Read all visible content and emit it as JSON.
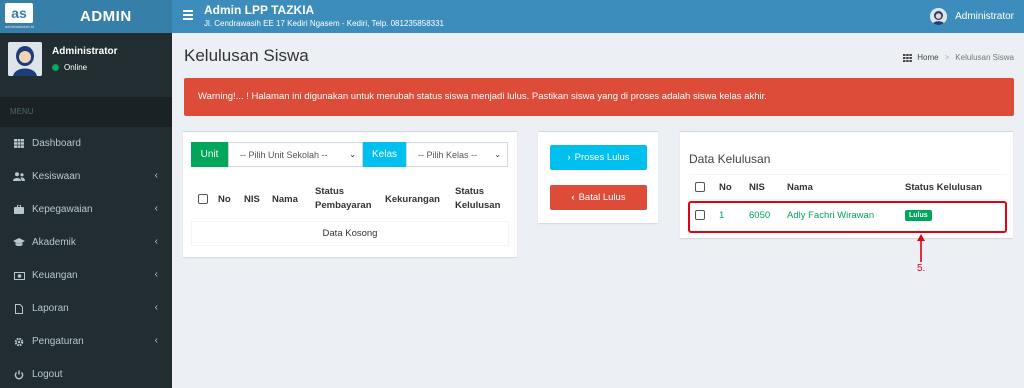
{
  "brand": {
    "logo_letters": "as",
    "logo_sub": "adminsekolah.id",
    "title": "ADMIN"
  },
  "user": {
    "name": "Administrator",
    "status": "Online"
  },
  "menu_header": "MENU",
  "menu": [
    {
      "label": "Dashboard",
      "icon": "th-icon",
      "has_children": false
    },
    {
      "label": "Kesiswaan",
      "icon": "users-icon",
      "has_children": true
    },
    {
      "label": "Kepegawaian",
      "icon": "briefcase-icon",
      "has_children": true
    },
    {
      "label": "Akademik",
      "icon": "graduation-cap-icon",
      "has_children": true
    },
    {
      "label": "Keuangan",
      "icon": "money-icon",
      "has_children": true
    },
    {
      "label": "Laporan",
      "icon": "file-icon",
      "has_children": true
    },
    {
      "label": "Pengaturan",
      "icon": "gear-icon",
      "has_children": true
    },
    {
      "label": "Logout",
      "icon": "power-icon",
      "has_children": false
    }
  ],
  "topbar": {
    "title": "Admin LPP TAZKIA",
    "address": "Jl. Cendrawasih EE 17 Kediri Ngasem - Kediri, Telp. 081235858331",
    "user": "Administrator"
  },
  "page": {
    "title": "Kelulusan Siswa",
    "breadcrumb": {
      "home": "Home",
      "current": "Kelulusan Siswa"
    },
    "warning": "Warning!... ! Halaman ini digunakan untuk merubah status siswa menjadi lulus. Pastikan siswa yang di proses adalah siswa kelas akhir."
  },
  "left_box": {
    "unit_label": "Unit",
    "unit_select": "-- Pilih Unit Sekolah --",
    "kelas_label": "Kelas",
    "kelas_select": "-- Pilih Kelas --",
    "columns": [
      "No",
      "NIS",
      "Nama",
      "Status Pembayaran",
      "Kekurangan",
      "Status Kelulusan"
    ],
    "empty": "Data Kosong"
  },
  "buttons": {
    "proses": "Proses Lulus",
    "batal": "Batal Lulus"
  },
  "right_box": {
    "title": "Data Kelulusan",
    "columns": [
      "No",
      "NIS",
      "Nama",
      "Status Kelulusan"
    ],
    "rows": [
      {
        "no": "1",
        "nis": "6050",
        "nama": "Adly Fachri Wirawan",
        "status": "Lulus"
      }
    ]
  },
  "annotation": "5.",
  "colors": {
    "sidebar": "#222d32",
    "topbar": "#3c8dbc",
    "logo": "#367fa9",
    "success": "#00a65a",
    "info": "#00c0ef",
    "danger": "#dd4b39",
    "annotation": "#e3000f"
  }
}
